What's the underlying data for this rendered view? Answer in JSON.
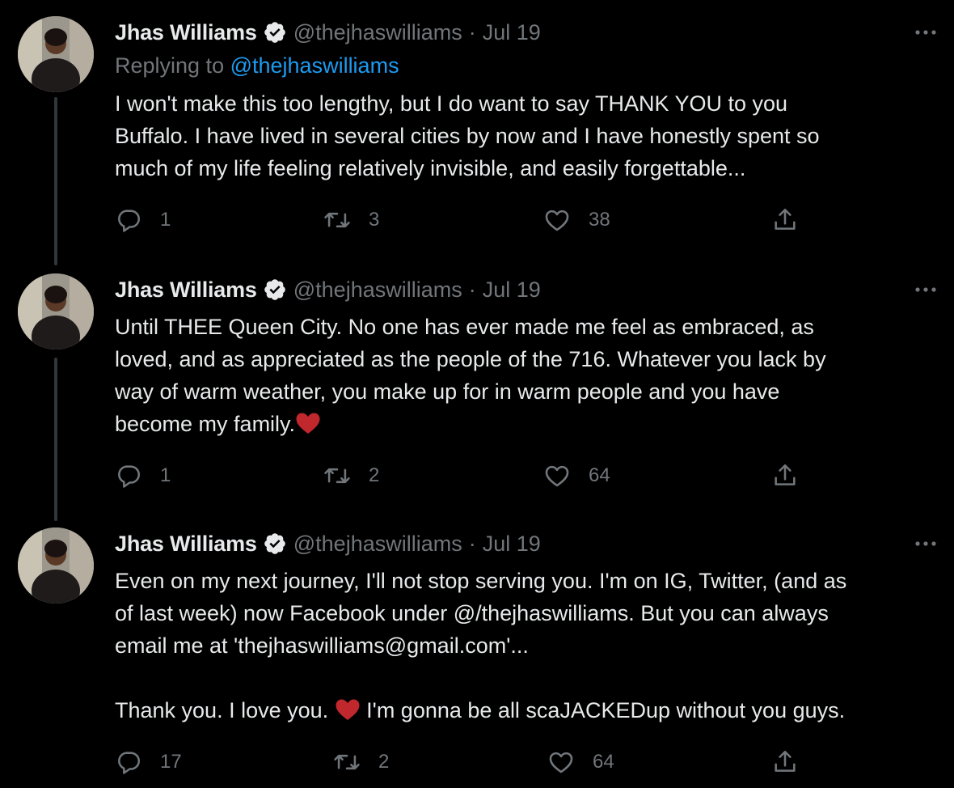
{
  "tweets": [
    {
      "name": "Jhas Williams",
      "handle": "@thejhaswilliams",
      "sep": "·",
      "date": "Jul 19",
      "replying_prefix": "Replying to ",
      "replying_handle": "@thejhaswilliams",
      "lines": [
        "I won't make this too lengthy, but I do want to say THANK YOU to you",
        "Buffalo. I have lived in several cities by now and I have honestly spent so",
        "much of my life feeling relatively invisible, and easily forgettable..."
      ],
      "replies": "1",
      "retweets": "3",
      "likes": "38"
    },
    {
      "name": "Jhas Williams",
      "handle": "@thejhaswilliams",
      "sep": "·",
      "date": "Jul 19",
      "lines": [
        "Until THEE Queen City. No one has ever made me feel as embraced, as",
        "loved, and as appreciated as the people of the 716. Whatever you lack by",
        "way of warm weather, you make up for in warm people and you have",
        "become my family."
      ],
      "replies": "1",
      "retweets": "2",
      "likes": "64"
    },
    {
      "name": "Jhas Williams",
      "handle": "@thejhaswilliams",
      "sep": "·",
      "date": "Jul 19",
      "lines": [
        "Even on my next journey, I'll not stop serving you. I'm on IG, Twitter, (and as",
        "of last week) now Facebook under @/thejhaswilliams. But you can always",
        "email me at 'thejhaswilliams@gmail.com'...",
        "",
        "Thank you. I love you. ",
        " I'm gonna be all scaJACKEDup without you guys."
      ],
      "replies": "17",
      "retweets": "2",
      "likes": "64"
    }
  ],
  "icons": {
    "verified": "verified-badge-icon",
    "more": "more-options-icon",
    "reply": "reply-icon",
    "retweet": "retweet-icon",
    "like": "like-icon",
    "share": "share-icon",
    "heart_emoji": "red-heart-emoji-icon"
  },
  "colors": {
    "background": "#000000",
    "text": "#e7e9ea",
    "muted": "#71767b",
    "link": "#1d9bf0",
    "heart": "#c0282d"
  }
}
